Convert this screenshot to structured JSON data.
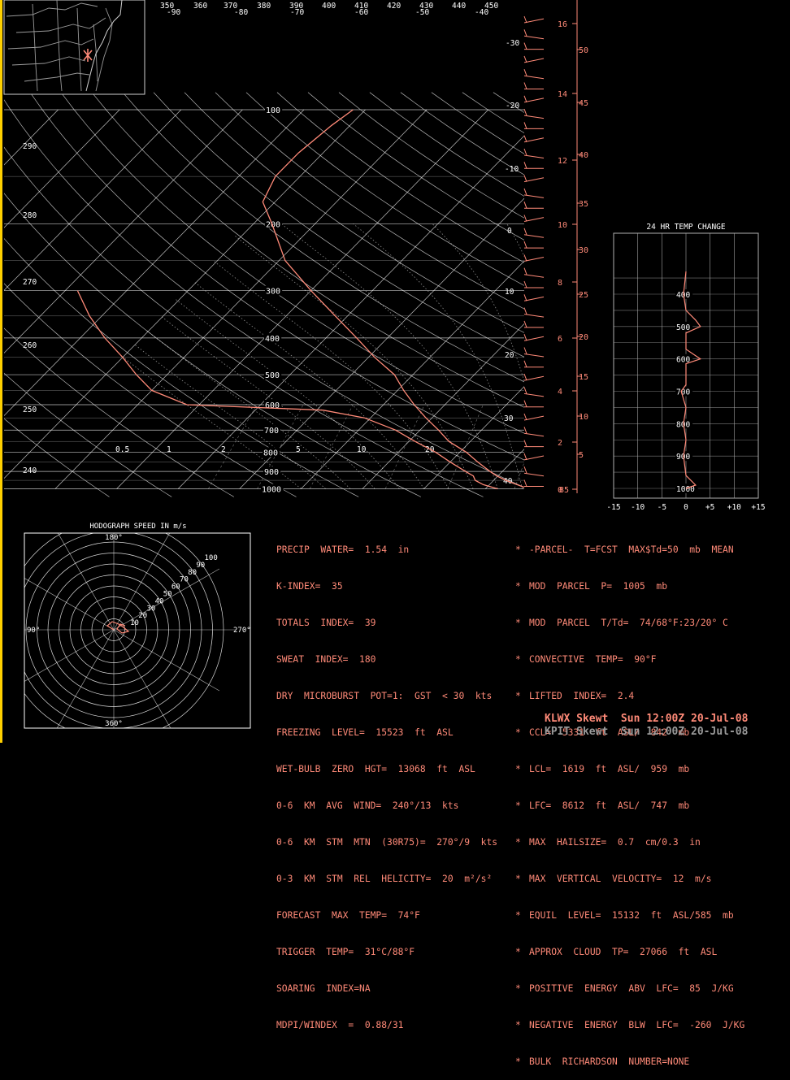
{
  "colors": {
    "background": "#000000",
    "grid": "#ffffff",
    "sounding": "#ff8a78",
    "accent_border": "#ffd000",
    "panel_grid": "#b0b0b0"
  },
  "chart_data": [
    {
      "type": "line",
      "name": "skewt",
      "pressure_labels": [
        "100",
        "200",
        "300",
        "400",
        "500",
        "600",
        "700",
        "800",
        "900",
        "1000"
      ],
      "theta_labels": [
        "290",
        "280",
        "270",
        "260",
        "250",
        "240"
      ],
      "top_labels": [
        "350",
        "360",
        "370",
        "380",
        "390",
        "400",
        "410",
        "420",
        "430",
        "440",
        "450"
      ],
      "top_temp_labels": [
        "-90",
        "-80",
        "-70",
        "-60",
        "-50",
        "-40"
      ],
      "diag_temp_labels": [
        "-30",
        "-20",
        "-10",
        "0",
        "10",
        "20",
        "30",
        "40"
      ],
      "mixing_ratio_labels": [
        "0.5",
        "1",
        "2",
        "5",
        "10",
        "20"
      ],
      "height_km_labels": [
        "16",
        "14",
        "12",
        "10",
        "8",
        "6",
        "4",
        "2",
        "0"
      ],
      "height_kft_labels": [
        "50",
        "45",
        "40",
        "35",
        "30",
        "25",
        "20",
        "15",
        "10",
        "5"
      ],
      "height_kft_bottom": "85",
      "temperature_profile": [
        {
          "p": 1000,
          "t": 27
        },
        {
          "p": 975,
          "t": 24.5
        },
        {
          "p": 950,
          "t": 22
        },
        {
          "p": 925,
          "t": 19.8
        },
        {
          "p": 900,
          "t": 18
        },
        {
          "p": 850,
          "t": 14.5
        },
        {
          "p": 800,
          "t": 11
        },
        {
          "p": 750,
          "t": 6.5
        },
        {
          "p": 700,
          "t": 3
        },
        {
          "p": 650,
          "t": -1
        },
        {
          "p": 600,
          "t": -5
        },
        {
          "p": 550,
          "t": -9
        },
        {
          "p": 500,
          "t": -13
        },
        {
          "p": 450,
          "t": -19
        },
        {
          "p": 400,
          "t": -25
        },
        {
          "p": 350,
          "t": -32
        },
        {
          "p": 300,
          "t": -40
        },
        {
          "p": 250,
          "t": -49
        },
        {
          "p": 200,
          "t": -57
        },
        {
          "p": 175,
          "t": -62
        },
        {
          "p": 150,
          "t": -64
        },
        {
          "p": 130,
          "t": -64
        },
        {
          "p": 110,
          "t": -63
        },
        {
          "p": 100,
          "t": -62
        }
      ],
      "dewpoint_profile": [
        {
          "p": 1000,
          "t": 22
        },
        {
          "p": 975,
          "t": 19
        },
        {
          "p": 950,
          "t": 17
        },
        {
          "p": 925,
          "t": 16
        },
        {
          "p": 900,
          "t": 14
        },
        {
          "p": 850,
          "t": 10
        },
        {
          "p": 800,
          "t": 6
        },
        {
          "p": 750,
          "t": 1
        },
        {
          "p": 700,
          "t": -4
        },
        {
          "p": 650,
          "t": -11
        },
        {
          "p": 620,
          "t": -19
        },
        {
          "p": 600,
          "t": -42
        },
        {
          "p": 550,
          "t": -50
        },
        {
          "p": 500,
          "t": -55
        },
        {
          "p": 450,
          "t": -60
        },
        {
          "p": 400,
          "t": -66
        },
        {
          "p": 350,
          "t": -72
        },
        {
          "p": 300,
          "t": -78
        }
      ]
    },
    {
      "type": "line",
      "name": "24hr_temp_change",
      "title": "24 HR TEMP CHANGE",
      "x_tick_labels": [
        "-15",
        "-10",
        "-5",
        "0",
        "+5",
        "+10",
        "+15"
      ],
      "xlim": [
        -15,
        15
      ],
      "pressure_labels": [
        "400",
        "500",
        "600",
        "700",
        "800",
        "900",
        "1000"
      ],
      "profile": [
        {
          "p": 330,
          "dt": 0
        },
        {
          "p": 400,
          "dt": -0.5
        },
        {
          "p": 450,
          "dt": 0
        },
        {
          "p": 480,
          "dt": 2
        },
        {
          "p": 500,
          "dt": 3
        },
        {
          "p": 520,
          "dt": 0
        },
        {
          "p": 570,
          "dt": 0
        },
        {
          "p": 590,
          "dt": 2
        },
        {
          "p": 600,
          "dt": 3
        },
        {
          "p": 615,
          "dt": 0
        },
        {
          "p": 680,
          "dt": 0
        },
        {
          "p": 700,
          "dt": -1
        },
        {
          "p": 750,
          "dt": 0
        },
        {
          "p": 800,
          "dt": -0.5
        },
        {
          "p": 850,
          "dt": 0
        },
        {
          "p": 900,
          "dt": -0.5
        },
        {
          "p": 960,
          "dt": 0
        },
        {
          "p": 990,
          "dt": 2
        },
        {
          "p": 1000,
          "dt": 0
        }
      ]
    },
    {
      "type": "scatter",
      "name": "hodograph",
      "title": "HODOGRAPH SPEED IN m/s",
      "ring_labels": [
        "10",
        "20",
        "30",
        "40",
        "50",
        "60",
        "70",
        "80",
        "90",
        "100"
      ],
      "direction_labels": {
        "top": "180°",
        "bottom": "360°",
        "left": "90°",
        "right": "270°"
      }
    }
  ],
  "stats_left": [
    "PRECIP  WATER=  1.54  in",
    "K-INDEX=  35",
    "TOTALS  INDEX=  39",
    "SWEAT  INDEX=  180",
    "DRY  MICROBURST  POT=1:  GST  < 30  kts",
    "FREEZING  LEVEL=  15523  ft  ASL",
    "WET-BULB  ZERO  HGT=  13068  ft  ASL",
    "0-6  KM  AVG  WIND=  240°/13  kts",
    "0-6  KM  STM  MTN  (30R75)=  270°/9  kts",
    "0-3  KM  STM  REL  HELICITY=  20  m²/s²",
    "FORECAST  MAX  TEMP=  74°F",
    "TRIGGER  TEMP=  31°C/88°F",
    "SOARING  INDEX=NA",
    "MDPI/WINDEX  =  0.88/31"
  ],
  "stats_right": [
    "-PARCEL-  T=FCST  MAX$Td=50  mb  MEAN",
    "MOD  PARCEL  P=  1005  mb",
    "MOD  PARCEL  T/Td=  74/68°F:23/20° C",
    "CONVECTIVE  TEMP=  90°F",
    "LIFTED  INDEX=  2.4",
    "CCL=  5331  ft  ASL/  842  mb",
    "LCL=  1619  ft  ASL/  959  mb",
    "LFC=  8612  ft  ASL/  747  mb",
    "MAX  HAILSIZE=  0.7  cm/0.3  in",
    "MAX  VERTICAL  VELOCITY=  12  m/s",
    "EQUIL  LEVEL=  15132  ft  ASL/585  mb",
    "APPROX  CLOUD  TP=  27066  ft  ASL",
    "POSITIVE  ENERGY  ABV  LFC=  85  J/KG",
    "NEGATIVE  ENERGY  BLW  LFC=  -260  J/KG",
    "BULK  RICHARDSON  NUMBER=NONE"
  ],
  "separator": "*",
  "footer": {
    "line1": "KLWX Skewt  Sun 12:00Z 20-Jul-08",
    "line2": "KPIT Skewt  Sun 12:00Z 20-Jul-08"
  }
}
